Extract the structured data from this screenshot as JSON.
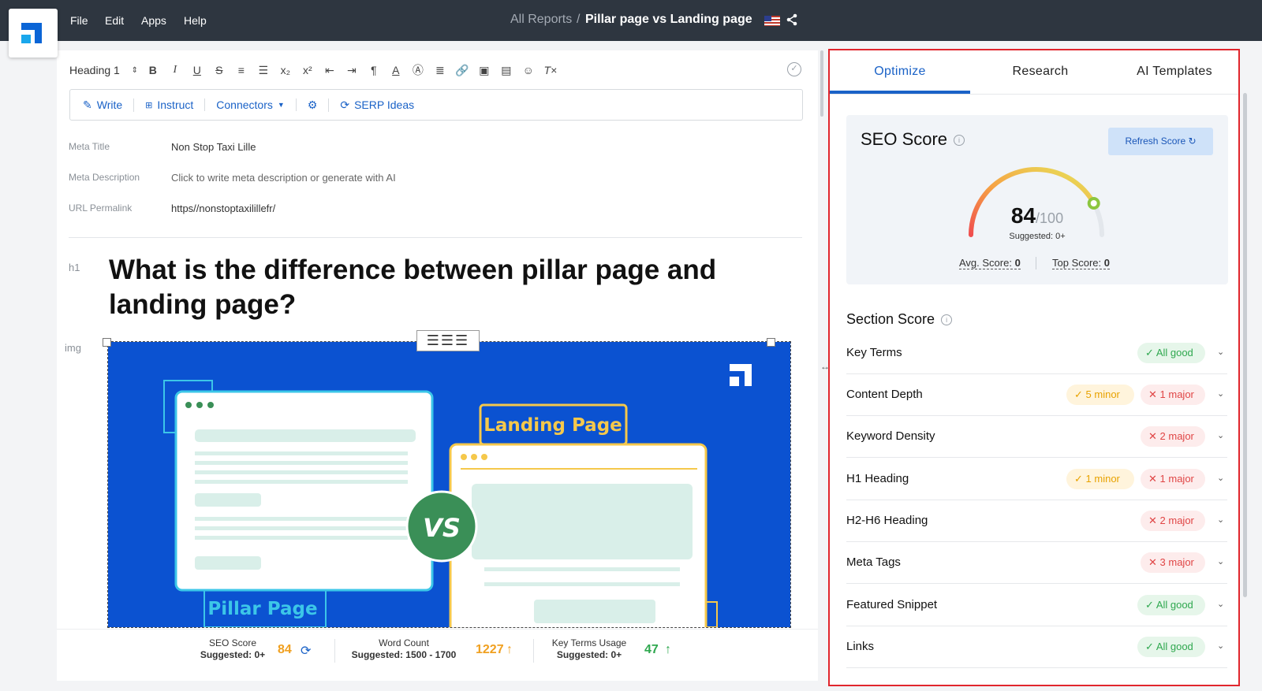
{
  "menu": {
    "file": "File",
    "edit": "Edit",
    "apps": "Apps",
    "help": "Help"
  },
  "breadcrumb": {
    "parent": "All Reports",
    "separator": "/",
    "current": "Pillar page vs Landing page"
  },
  "toolbar": {
    "heading_select": "Heading 1"
  },
  "tools": {
    "write": "Write",
    "instruct": "Instruct",
    "connectors": "Connectors",
    "serp": "SERP Ideas"
  },
  "meta": {
    "title_label": "Meta Title",
    "title_value": "Non Stop Taxi Lille",
    "desc_label": "Meta Description",
    "desc_value": "Click to write meta description or generate with AI",
    "url_label": "URL Permalink",
    "url_value": "https//nonstoptaxilillefr/"
  },
  "content": {
    "h1_tag": "h1",
    "h1_text": "What is the difference between pillar page and landing page?",
    "img_tag": "img",
    "image_texts": {
      "landing": "Landing Page",
      "vs": "VS",
      "pillar": "Pillar Page"
    }
  },
  "status": {
    "seo_label": "SEO Score",
    "seo_sub": "Suggested: 0+",
    "seo_value": "84",
    "wc_label": "Word Count",
    "wc_sub": "Suggested: 1500 - 1700",
    "wc_value": "1227",
    "kt_label": "Key Terms Usage",
    "kt_sub": "Suggested: 0+",
    "kt_value": "47",
    "colors": {
      "orange": "#f0a020",
      "green": "#2fa84f"
    }
  },
  "panel": {
    "tabs": [
      "Optimize",
      "Research",
      "AI Templates"
    ],
    "seo": {
      "title": "SEO Score",
      "refresh": "Refresh Score",
      "score": "84",
      "max": "/100",
      "suggested": "Suggested: 0+",
      "avg_label": "Avg. Score:",
      "avg_value": "0",
      "top_label": "Top Score:",
      "top_value": "0",
      "gauge_fraction": 0.84
    },
    "section_title": "Section Score",
    "rows": [
      {
        "label": "Key Terms",
        "good": "All good"
      },
      {
        "label": "Content Depth",
        "minor": "5 minor",
        "major": "1 major"
      },
      {
        "label": "Keyword Density",
        "major": "2 major"
      },
      {
        "label": "H1 Heading",
        "minor": "1 minor",
        "major": "1 major"
      },
      {
        "label": "H2-H6 Heading",
        "major": "2 major"
      },
      {
        "label": "Meta Tags",
        "major": "3 major"
      },
      {
        "label": "Featured Snippet",
        "good": "All good"
      },
      {
        "label": "Links",
        "good": "All good"
      }
    ]
  }
}
